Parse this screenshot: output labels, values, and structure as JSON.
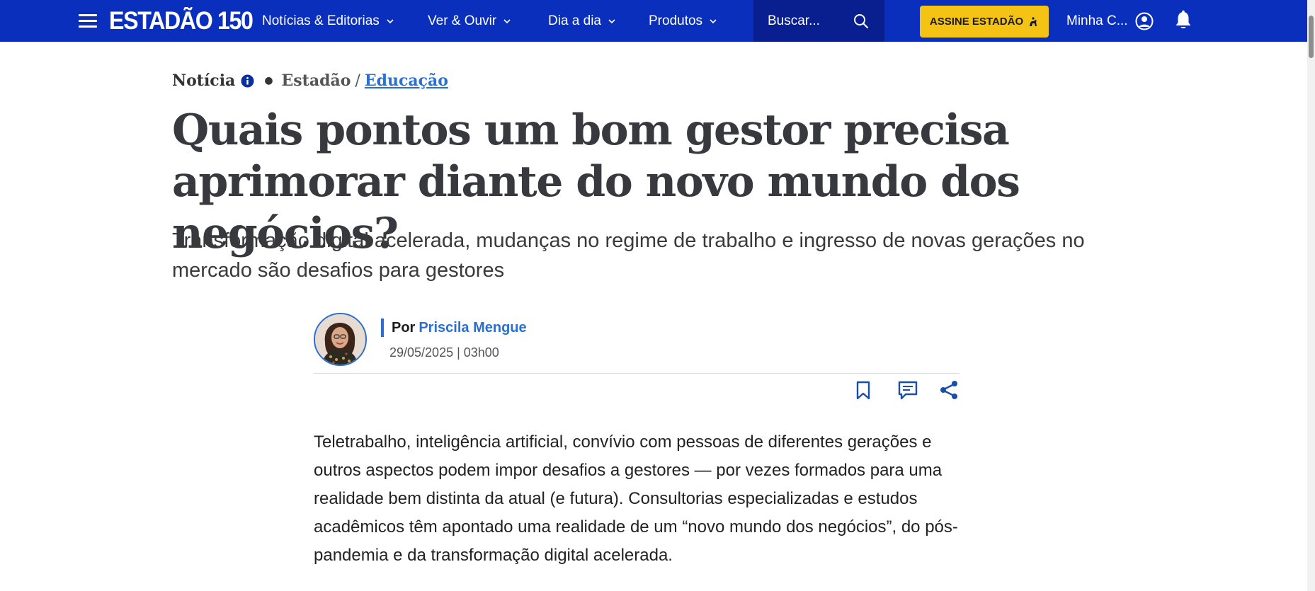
{
  "header": {
    "logo_text": "ESTADÃO 150",
    "nav": [
      {
        "label": "Notícias & Editorias"
      },
      {
        "label": "Ver & Ouvir"
      },
      {
        "label": "Dia a dia"
      },
      {
        "label": "Produtos"
      }
    ],
    "search_placeholder": "Buscar...",
    "subscribe_label": "ASSINE ESTADÃO",
    "account_label": "Minha C...",
    "brand_color": "#0a2fbd",
    "accent_color": "#f5c314"
  },
  "article": {
    "kind": "Notícia",
    "source": "Estadão",
    "separator": "/",
    "section": "Educação",
    "headline": "Quais pontos um bom gestor precisa aprimorar diante do novo mundo dos negócios?",
    "subhead": "Transformação digital acelerada, mudanças no regime de trabalho e ingresso de novas gerações no mercado são desafios para gestores",
    "byline_prefix": "Por",
    "author": "Priscila Mengue",
    "date": "29/05/2025 | 03h00",
    "body": "Teletrabalho, inteligência artificial, convívio com pessoas de diferentes gerações e outros aspectos podem impor desafios a gestores — por vezes formados para uma realidade bem distinta da atual (e futura). Consultorias especializadas e estudos acadêmicos têm apontado uma realidade de um “novo mundo dos negócios”, do pós-pandemia e da transformação digital acelerada.",
    "link_color": "#2a6fd1"
  },
  "icons": {
    "menu": "hamburger-menu-icon",
    "search": "search-icon",
    "account": "user-icon",
    "notifications": "bell-icon",
    "info": "info-icon",
    "save": "bookmark-icon",
    "comments": "comment-icon",
    "share": "share-icon"
  }
}
